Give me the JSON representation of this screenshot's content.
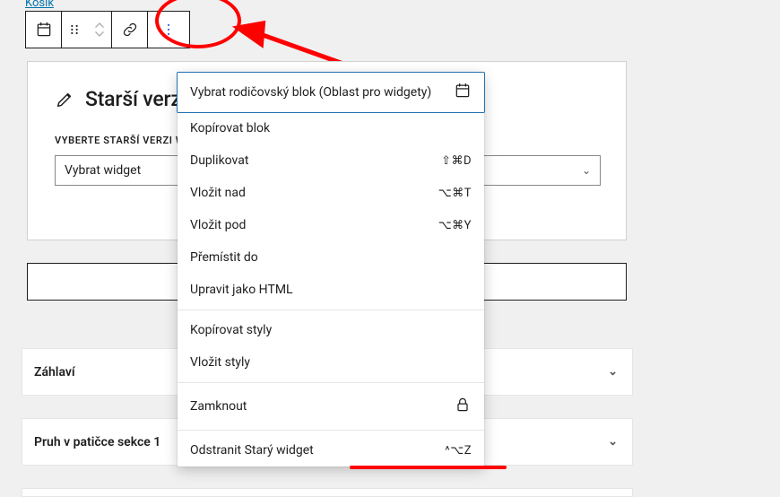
{
  "link": {
    "label": "Košík"
  },
  "panel": {
    "title": "Starší verze widgetu",
    "select_label": "VYBERTE STARŠÍ VERZI WIDGETU:",
    "select_value": "Vybrat widget"
  },
  "sections": {
    "a": "Záhlaví",
    "b": "Pruh v patičce sekce 1"
  },
  "menu": {
    "parent": "Vybrat rodičovský blok (Oblast pro widgety)",
    "copy_block": "Kopírovat blok",
    "duplicate": "Duplikovat",
    "duplicate_sc": "⇧⌘D",
    "insert_before": "Vložit nad",
    "insert_before_sc": "⌥⌘T",
    "insert_after": "Vložit pod",
    "insert_after_sc": "⌥⌘Y",
    "move_to": "Přemístit do",
    "edit_html": "Upravit jako HTML",
    "copy_styles": "Kopírovat styly",
    "paste_styles": "Vložit styly",
    "lock": "Zamknout",
    "remove": "Odstranit Starý widget",
    "remove_sc": "^⌥Z"
  }
}
